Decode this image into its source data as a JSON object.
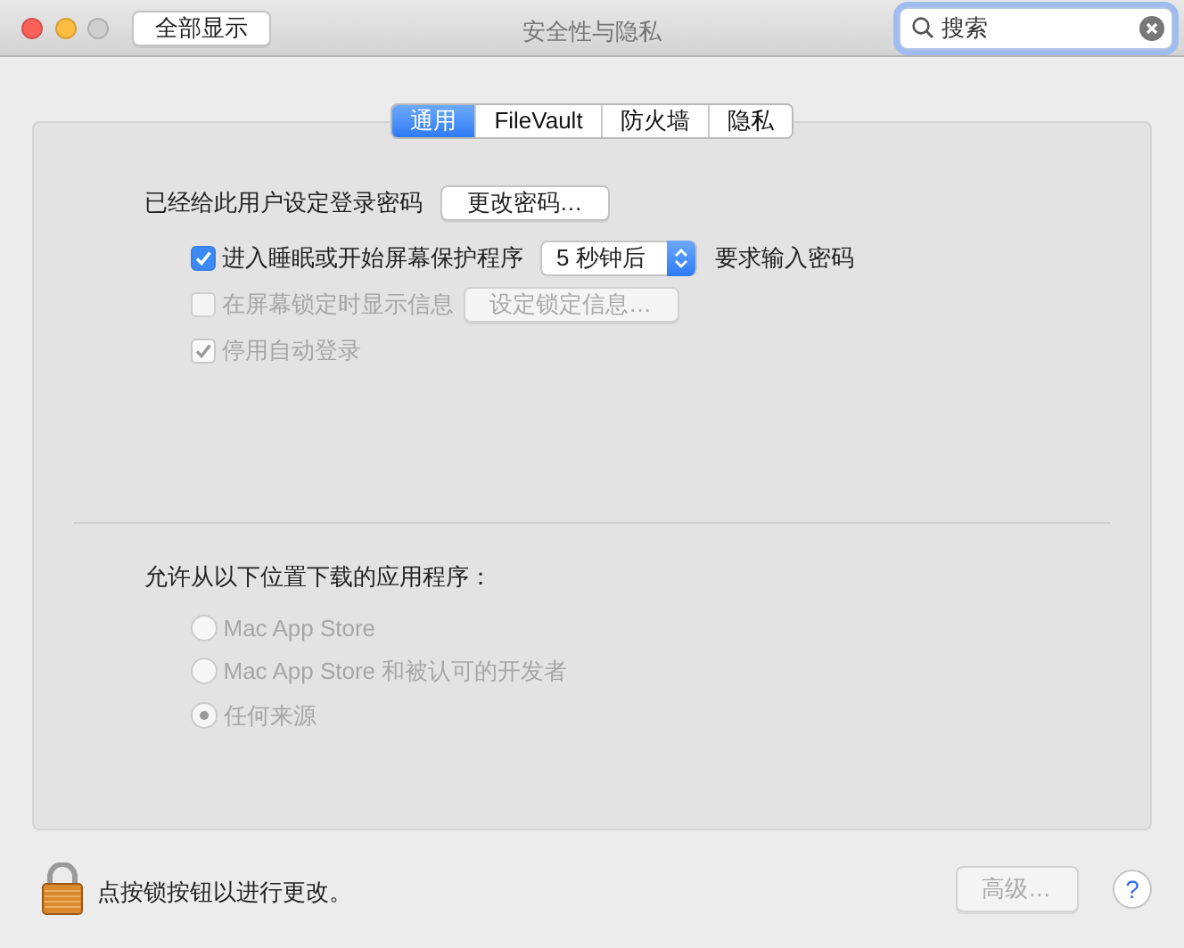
{
  "window": {
    "title": "安全性与隐私"
  },
  "toolbar": {
    "show_all_button": "全部显示",
    "search": {
      "value": "搜索"
    }
  },
  "tabs": [
    {
      "label": "通用",
      "selected": true
    },
    {
      "label": "FileVault",
      "selected": false
    },
    {
      "label": "防火墙",
      "selected": false
    },
    {
      "label": "隐私",
      "selected": false
    }
  ],
  "general": {
    "password_label": "已经给此用户设定登录密码",
    "change_password_button": "更改密码…",
    "options": [
      {
        "kind": "select",
        "label": "进入睡眠或开始屏幕保护程序",
        "checked": true,
        "disabled": false,
        "select_value": "5 秒钟后",
        "trailing_text": "要求输入密码"
      },
      {
        "kind": "button",
        "label": "在屏幕锁定时显示信息",
        "checked": false,
        "disabled": true,
        "button": "设定锁定信息…"
      },
      {
        "kind": "plain",
        "label": "停用自动登录",
        "checked": true,
        "disabled": true
      }
    ]
  },
  "downloads": {
    "heading": "允许从以下位置下载的应用程序：",
    "options": [
      {
        "label": "Mac App Store",
        "selected": false,
        "disabled": true
      },
      {
        "label": "Mac App Store 和被认可的开发者",
        "selected": false,
        "disabled": true
      },
      {
        "label": "任何来源",
        "selected": true,
        "disabled": true
      }
    ]
  },
  "footer": {
    "lock_text": "点按锁按钮以进行更改。",
    "advanced_button": {
      "label": "高级…",
      "disabled": true
    },
    "help_button": "?"
  }
}
